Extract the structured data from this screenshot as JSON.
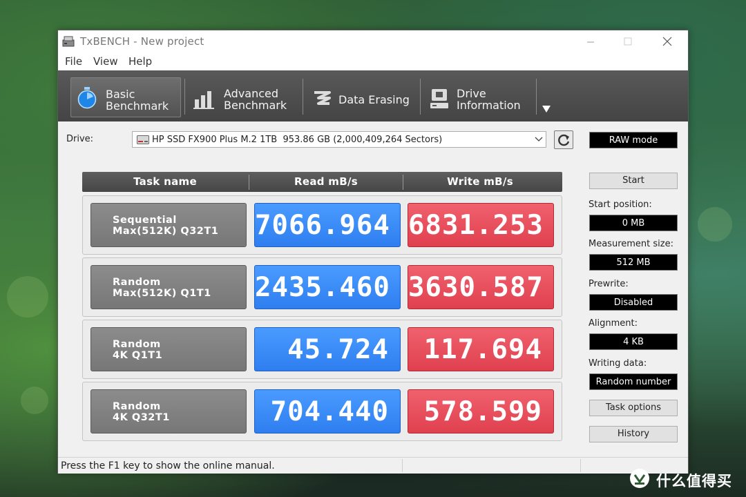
{
  "window": {
    "title": "TxBENCH - New project"
  },
  "menu": {
    "items": [
      "File",
      "View",
      "Help"
    ]
  },
  "tabs": [
    {
      "label": "Basic\nBenchmark",
      "icon": "stopwatch-icon"
    },
    {
      "label": "Advanced\nBenchmark",
      "icon": "bar-chart-icon"
    },
    {
      "label": "Data Erasing",
      "icon": "eraser-icon"
    },
    {
      "label": "Drive\nInformation",
      "icon": "drive-icon"
    }
  ],
  "drive": {
    "label": "Drive:",
    "value": "HP SSD FX900 Plus M.2 1TB  953.86 GB (2,000,409,264 Sectors)"
  },
  "side": {
    "mode": "RAW mode",
    "start_label": "Start",
    "start_position_label": "Start position:",
    "start_position": "0 MB",
    "measurement_size_label": "Measurement size:",
    "measurement_size": "512 MB",
    "prewrite_label": "Prewrite:",
    "prewrite": "Disabled",
    "alignment_label": "Alignment:",
    "alignment": "4 KB",
    "writing_data_label": "Writing data:",
    "writing_data": "Random number",
    "task_options_label": "Task options",
    "history_label": "History"
  },
  "table": {
    "headers": [
      "Task name",
      "Read mB/s",
      "Write mB/s"
    ],
    "rows": [
      {
        "name1": "Sequential",
        "name2": "Max(512K) Q32T1",
        "read": "7066.964",
        "write": "6831.253"
      },
      {
        "name1": "Random",
        "name2": "Max(512K) Q1T1",
        "read": "2435.460",
        "write": "3630.587"
      },
      {
        "name1": "Random",
        "name2": "4K Q1T1",
        "read": "45.724",
        "write": "117.694"
      },
      {
        "name1": "Random",
        "name2": "4K Q32T1",
        "read": "704.440",
        "write": "578.599"
      }
    ]
  },
  "status": {
    "text": "Press the F1 key to show the online manual."
  },
  "watermark": {
    "text": "什么值得买",
    "icon": "smzdm-logo-icon"
  },
  "colors": {
    "read": "#3586f6",
    "write": "#e74b58",
    "toolbar": "#4d4d4d"
  }
}
